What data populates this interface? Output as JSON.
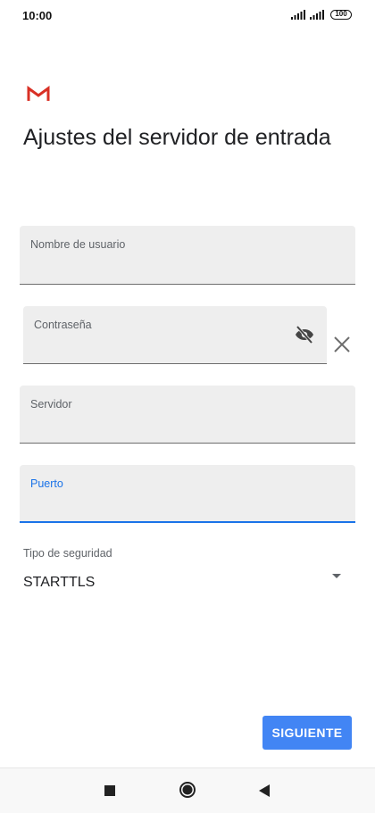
{
  "status_bar": {
    "time": "10:00",
    "battery": "100",
    "icons": [
      "signal-icon",
      "signal-icon",
      "battery-icon"
    ]
  },
  "app": {
    "logo": "gmail-logo",
    "colors": {
      "accent": "#4285f4",
      "focus": "#1a73e8",
      "logo_red": "#d93025"
    }
  },
  "title": "Ajustes del servidor de entrada",
  "fields": {
    "username": {
      "label": "Nombre de usuario",
      "value": ""
    },
    "password": {
      "label": "Contraseña",
      "value": "",
      "toggle_icon": "visibility-off-icon",
      "clear_icon": "close-icon"
    },
    "server": {
      "label": "Servidor",
      "value": ""
    },
    "port": {
      "label": "Puerto",
      "value": "",
      "focused": true
    }
  },
  "security": {
    "label": "Tipo de seguridad",
    "selected": "STARTTLS",
    "icon": "dropdown-arrow-icon"
  },
  "next_button": {
    "label": "SIGUIENTE"
  },
  "nav_bar": {
    "icons": [
      "recent-apps-icon",
      "home-icon",
      "back-icon"
    ]
  }
}
